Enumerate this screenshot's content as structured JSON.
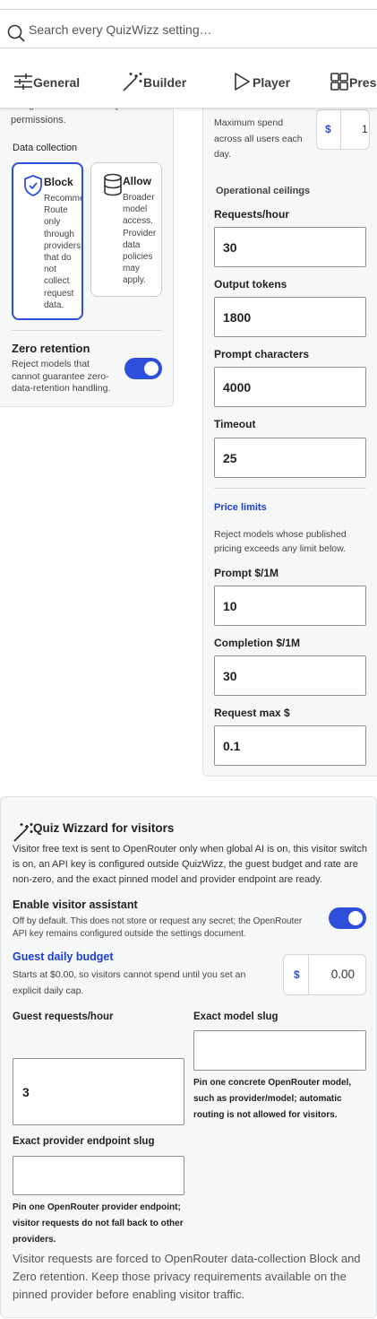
{
  "search": {
    "placeholder": "Search every QuizWizz setting…"
  },
  "tabs": [
    {
      "label": "General",
      "icon": "sliders-icon"
    },
    {
      "label": "Builder",
      "icon": "magic-wand-icon"
    },
    {
      "label": "Player",
      "icon": "play-icon"
    },
    {
      "label": "Prese",
      "icon": "grid-icon"
    }
  ],
  "left_panel": {
    "clipped_top_line": "to signed-in users with QuizWizz",
    "permissions_text": "permissions.",
    "data_collection_label": "Data collection",
    "options": [
      {
        "title": "Block",
        "desc": "Recommende\nRoute\nonly\nthrough\nproviders\nthat do\nnot\ncollect\nrequest\ndata.",
        "icon": "shield-check-icon",
        "selected": true
      },
      {
        "title": "Allow",
        "desc": "Broader\nmodel\naccess.\nProvider\ndata\npolicies\nmay\napply.",
        "icon": "database-icon",
        "selected": false
      }
    ],
    "zero_retention_label": "Zero retention",
    "zero_retention_desc": "Reject models that cannot guarantee zero-data-retention handling.",
    "zero_retention_on": true
  },
  "right_panel": {
    "daily_desc": "Maximum spend across all users each day.",
    "daily_currency": "$",
    "daily_value": "1",
    "operational_heading": "Operational ceilings",
    "ceilings": [
      {
        "label": "Requests/hour",
        "value": "30"
      },
      {
        "label": "Output tokens",
        "value": "1800"
      },
      {
        "label": "Prompt characters",
        "value": "4000"
      },
      {
        "label": "Timeout",
        "value": "25"
      }
    ],
    "price_heading": "Price limits",
    "price_desc": "Reject models whose published pricing exceeds any limit below.",
    "prices": [
      {
        "label": "Prompt $/1M",
        "value": "10"
      },
      {
        "label": "Completion $/1M",
        "value": "30"
      },
      {
        "label": "Request max $",
        "value": "0.1"
      }
    ]
  },
  "visitors": {
    "title": "Quiz Wizzard for visitors",
    "intro": "Visitor free text is sent to OpenRouter only when global AI is on, this visitor switch is on, an API key is configured outside QuizWizz, the guest budget and rate are non-zero, and the exact pinned model and provider endpoint are ready.",
    "enable_label": "Enable visitor assistant",
    "enable_desc": "Off by default. This does not store or request any secret; the OpenRouter API key remains configured outside the settings document.",
    "enable_on": true,
    "budget_label": "Guest daily budget",
    "budget_desc": "Starts at $0.00, so visitors cannot spend until you set an explicit daily cap.",
    "budget_currency": "$",
    "budget_value": "0.00",
    "guest_rph_label": "Guest requests/hour",
    "guest_rph_value": "3",
    "model_slug_label": "Exact model slug",
    "model_slug_value": "",
    "model_slug_help": "Pin one concrete OpenRouter model, such as provider/model; automatic routing is not allowed for visitors.",
    "provider_slug_label": "Exact provider endpoint slug",
    "provider_slug_value": "",
    "provider_slug_help": "Pin one OpenRouter provider endpoint; visitor requests do not fall back to other providers.",
    "footer_note": "Visitor requests are forced to OpenRouter data-collection Block and Zero retention. Keep those privacy requirements available on the pinned provider before enabling visitor traffic."
  },
  "colors": {
    "accent": "#2d4fdc",
    "heading_blue": "#1a3fd6",
    "panel_bg": "#f6f7f7"
  }
}
